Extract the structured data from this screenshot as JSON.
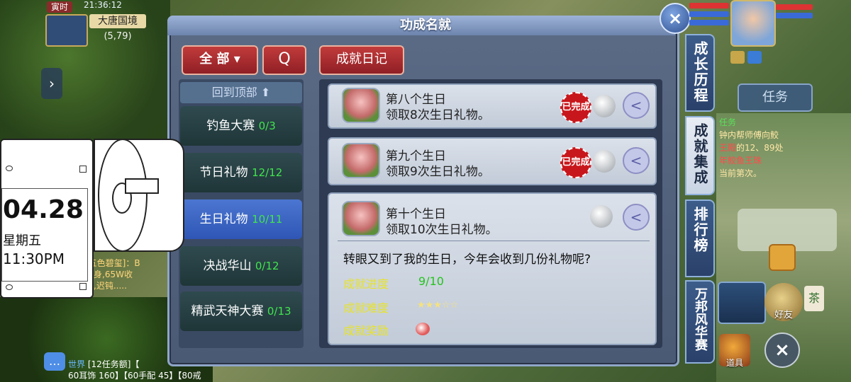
{
  "location": {
    "time_tag": "寅时",
    "clock": "21:36:12",
    "map_name": "大唐国境",
    "coords": "(5,79)"
  },
  "panel": {
    "title": "功成名就",
    "filter_label": "全 部",
    "search_label": "Q",
    "diary_label": "成就日记"
  },
  "categories": {
    "back_to_top": "回到顶部",
    "items": [
      {
        "name": "钓鱼大赛",
        "count": "0/3"
      },
      {
        "name": "节日礼物",
        "count": "12/12"
      },
      {
        "name": "生日礼物",
        "count": "10/11"
      },
      {
        "name": "决战华山",
        "count": "0/12"
      },
      {
        "name": "精武天神大赛",
        "count": "0/13"
      }
    ]
  },
  "achievements": [
    {
      "title": "第八个生日",
      "desc": "领取8次生日礼物。",
      "stamp": "已完成"
    },
    {
      "title": "第九个生日",
      "desc": "领取9次生日礼物。",
      "stamp": "已完成"
    },
    {
      "title": "第十个生日",
      "desc": "领取10次生日礼物。"
    }
  ],
  "detail": {
    "flavor": "转眼又到了我的生日，今年会收到几份礼物呢?",
    "progress_label": "成就进度",
    "progress_value": "9/10",
    "progress_fraction": 0.9,
    "difficulty_label": "成就难度",
    "difficulty_stars": "★★★☆☆",
    "difficulty_rating": 3,
    "reward_label": "成就奖励",
    "reward_icon": "peach-reward-icon"
  },
  "side_tabs": [
    {
      "label": "成长历程"
    },
    {
      "label": "成就集成"
    },
    {
      "label": "排行榜"
    },
    {
      "label": "万邦风华赛"
    }
  ],
  "hud": {
    "task_tab": "任务",
    "task_header": "任务",
    "task_line1": "钟内帮师傅向鲛",
    "task_line2_a": "王殿",
    "task_line2_b": "的12、89处",
    "task_line3": "年鲛鱼王珠",
    "task_line4": "当前第",
    "task_line4_b": "次。",
    "friend_label": "好友",
    "bag_label": "道具",
    "tag_glyph": "茶"
  },
  "chat": {
    "left_text_1": "[五色碧玺]：B",
    "left_text_2": "隐身,65W收",
    "left_text_3": "根,迟钝.....",
    "world_tag": "世界",
    "line1": "[12任务额]【",
    "line2": "60耳饰 160】【60手配 45】【80戒"
  },
  "calendar_widget": {
    "date": "04.28",
    "weekday": "星期五",
    "time": "11:30PM"
  },
  "colors": {
    "accent_red": "#c23b3b",
    "selected_blue": "#2f56b5",
    "count_green": "#41e44e",
    "label_yellow": "#e7e32a"
  }
}
